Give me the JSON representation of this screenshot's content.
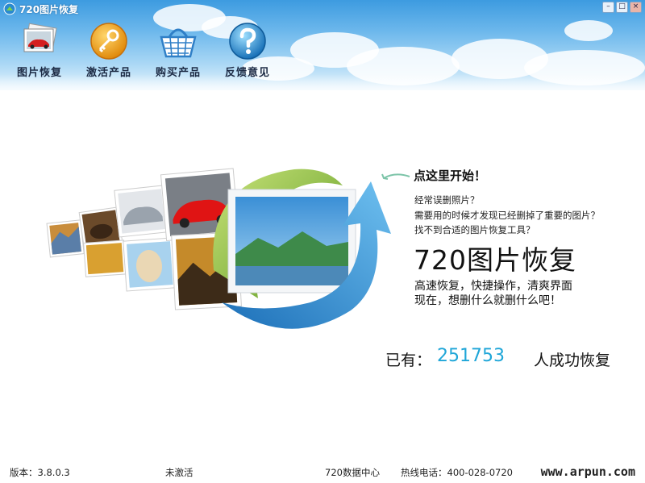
{
  "window": {
    "title": "720图片恢复",
    "minimize": "–",
    "maximize": "□",
    "close": "×"
  },
  "toolbar": [
    {
      "label": "图片恢复",
      "icon": "photo-stack-icon"
    },
    {
      "label": "激活产品",
      "icon": "key-icon"
    },
    {
      "label": "购买产品",
      "icon": "shopping-basket-icon"
    },
    {
      "label": "反馈意见",
      "icon": "help-question-icon"
    }
  ],
  "main": {
    "start": "点这里开始！",
    "questions": [
      "经常误删照片？",
      "需要用的时候才发现已经删掉了重要的图片？",
      "找不到合适的图片恢复工具？"
    ],
    "app_name": "720图片恢复",
    "slogan": [
      "高速恢复，快捷操作，清爽界面",
      "现在，想删什么就删什么吧！"
    ],
    "count_prefix": "已有：",
    "count_value": "251753",
    "count_suffix": "人成功恢复"
  },
  "status": {
    "version": "版本：3.8.0.3",
    "activation": "未激活",
    "center": "720数据中心",
    "hotline": "热线电话：400-028-0720",
    "watermark": "www.arpun.com"
  },
  "colors": {
    "accent": "#1fa6d8",
    "sky": "#3d9be0",
    "arrow_green": "#7fb83a",
    "arrow_blue": "#2f86cc"
  }
}
